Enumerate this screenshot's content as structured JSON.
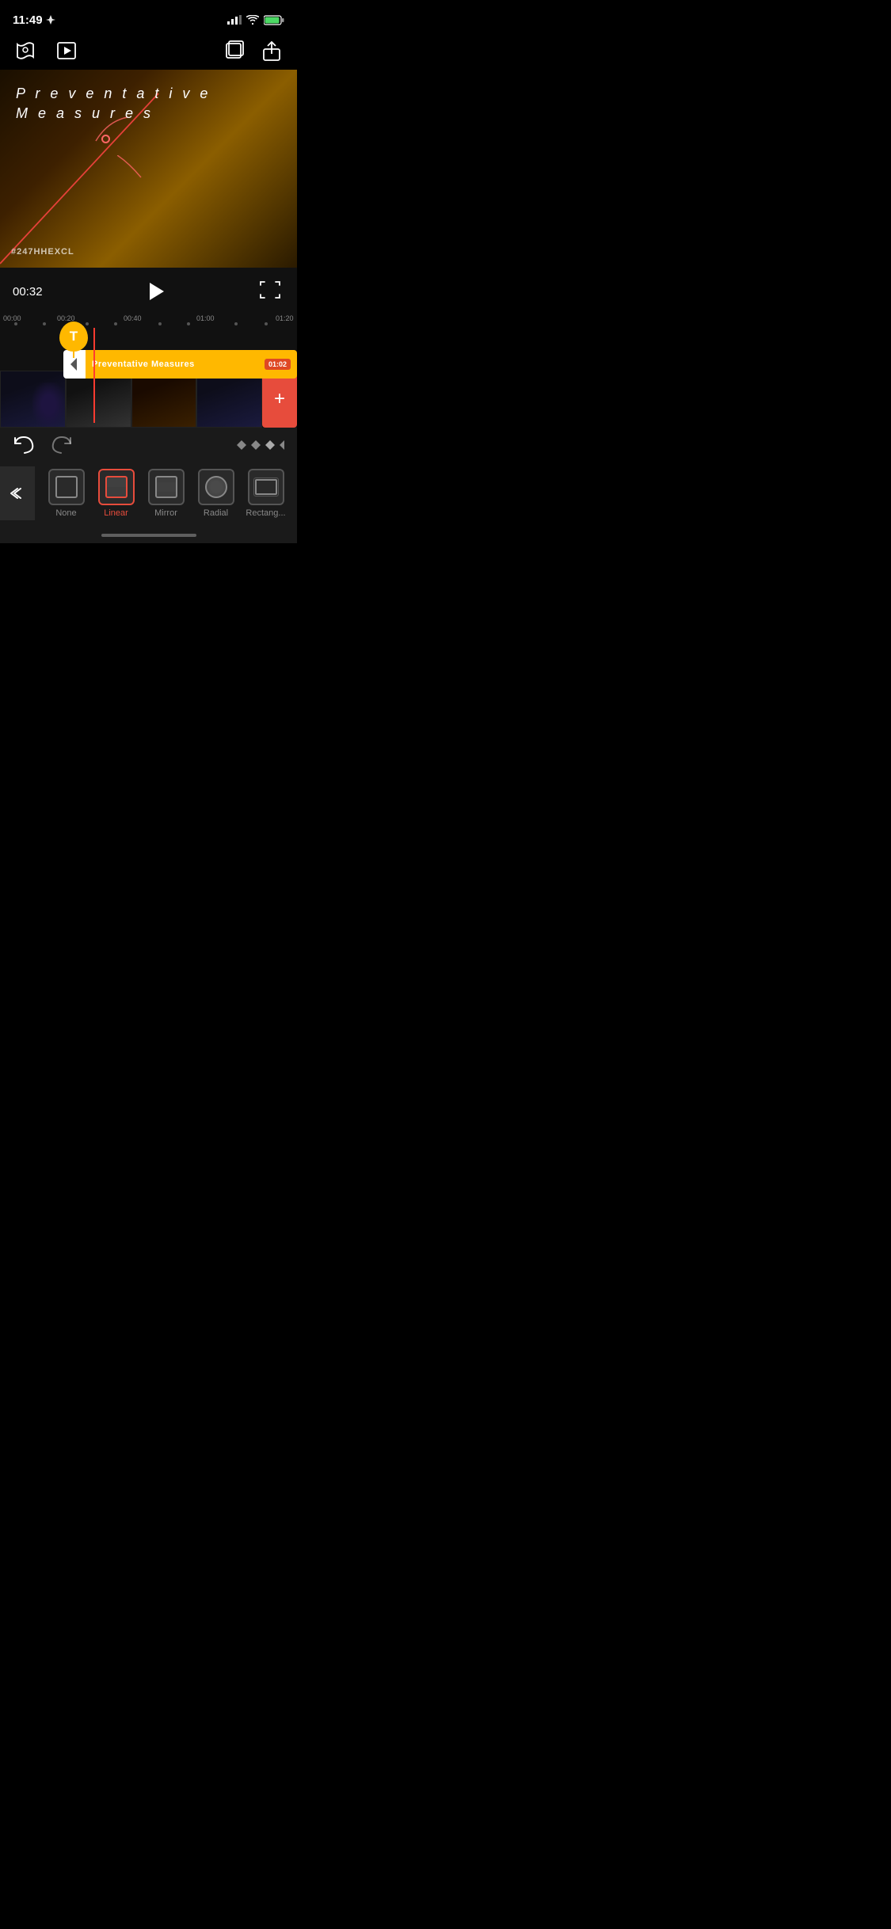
{
  "status": {
    "time": "11:49",
    "location_icon": "↗"
  },
  "toolbar": {
    "mask_icon": "mask",
    "preview_icon": "preview",
    "layers_icon": "layers",
    "share_icon": "share"
  },
  "video": {
    "overlay_line1": "P r e v e n t a t i v e",
    "overlay_line2": "M e a s u r e s",
    "watermark": "#247HHEXCL"
  },
  "playback": {
    "time": "00:32",
    "play_label": "Play"
  },
  "timeline": {
    "markers": [
      "00:00",
      "00:20",
      "00:40",
      "01:00",
      "01:20"
    ],
    "text_element": {
      "label": "Preventative  Measures",
      "duration": "01:02"
    }
  },
  "controls": {
    "undo_label": "Undo",
    "redo_label": "Redo"
  },
  "mask_options": [
    {
      "id": "none",
      "label": "None",
      "selected": false
    },
    {
      "id": "linear",
      "label": "Linear",
      "selected": true
    },
    {
      "id": "mirror",
      "label": "Mirror",
      "selected": false
    },
    {
      "id": "radial",
      "label": "Radial",
      "selected": false
    },
    {
      "id": "rectangle",
      "label": "Rectang...",
      "selected": false
    }
  ]
}
